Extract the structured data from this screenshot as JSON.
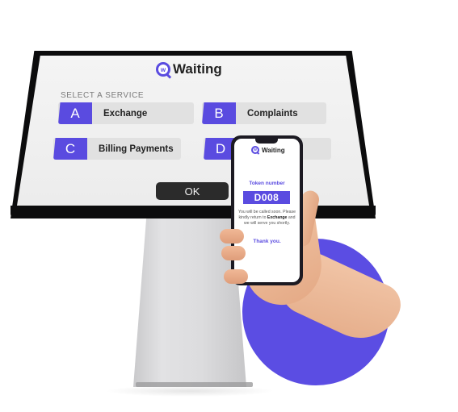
{
  "kiosk": {
    "brand": "Waiting",
    "logo_letter": "w",
    "select_label": "SELECT A SERVICE",
    "services": [
      {
        "letter": "A",
        "name": "Exchange"
      },
      {
        "letter": "B",
        "name": "Complaints"
      },
      {
        "letter": "C",
        "name": "Billing Payments"
      },
      {
        "letter": "D",
        "name": ""
      }
    ],
    "ok_label": "OK"
  },
  "phone": {
    "brand": "Waiting",
    "logo_letter": "w",
    "token_label": "Token number",
    "token": "D008",
    "message_pre": "You will be called soon. Please kindly return to",
    "message_service": "Exchange",
    "message_post": "and we will serve you shortly.",
    "thanks": "Thank you."
  },
  "colors": {
    "accent": "#5a4be0",
    "circle": "#5b4de3",
    "bezel": "#0c0c0d",
    "screen": "#f0f0f0",
    "ok_button": "#2b2b2b"
  }
}
